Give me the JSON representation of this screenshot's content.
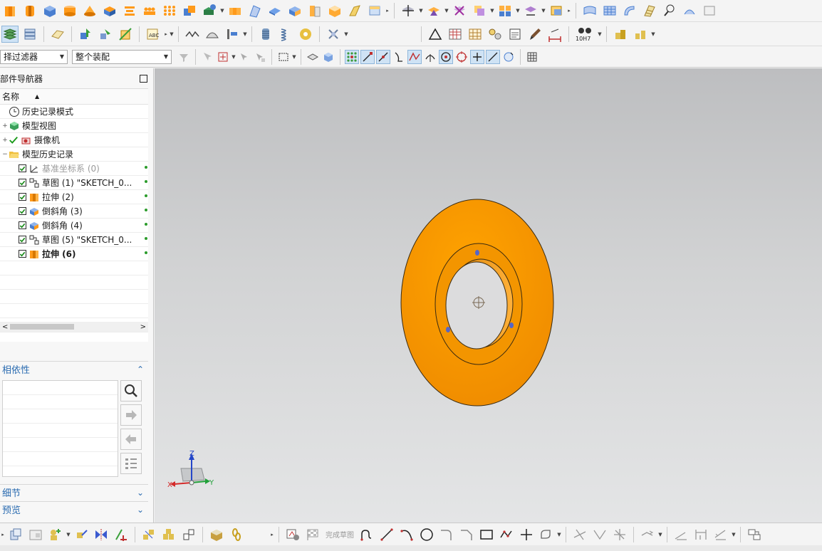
{
  "filter": {
    "selection_filter_value": "择过滤器",
    "assembly_scope_value": "整个装配"
  },
  "navigator": {
    "title": "部件导航器",
    "column_name": "名称",
    "items": [
      {
        "label": "历史记录模式",
        "icon": "clock-icon",
        "level": 0,
        "expander": ""
      },
      {
        "label": "模型视图",
        "icon": "model-views-icon",
        "level": 0,
        "expander": "+"
      },
      {
        "label": "摄像机",
        "icon": "camera-icon",
        "level": 0,
        "expander": "+"
      },
      {
        "label": "模型历史记录",
        "icon": "folder-open-icon",
        "level": 0,
        "expander": "−"
      },
      {
        "label": "基准坐标系 (0)",
        "icon": "datum-csys-icon",
        "level": 1,
        "dim": true
      },
      {
        "label": "草图 (1) \"SKETCH_0...",
        "icon": "sketch-icon",
        "level": 1
      },
      {
        "label": "拉伸 (2)",
        "icon": "extrude-icon",
        "level": 1
      },
      {
        "label": "倒斜角 (3)",
        "icon": "chamfer-icon",
        "level": 1
      },
      {
        "label": "倒斜角 (4)",
        "icon": "chamfer-icon",
        "level": 1
      },
      {
        "label": "草图 (5) \"SKETCH_0...",
        "icon": "sketch-icon",
        "level": 1
      },
      {
        "label": "拉伸 (6)",
        "icon": "extrude-icon",
        "level": 1,
        "bold": true
      }
    ]
  },
  "panels": {
    "dependencies": "相依性",
    "details": "细节",
    "preview": "预览"
  },
  "bottom_toolbar": {
    "finish_sketch": "完成草图"
  },
  "triad": {
    "x_label": "X",
    "y_label": "Y",
    "z_label": "Z"
  },
  "part": {
    "face_color": "#ff9f00",
    "edge_color": "#3a2a10"
  },
  "toolbar_spec_label": "10H7"
}
